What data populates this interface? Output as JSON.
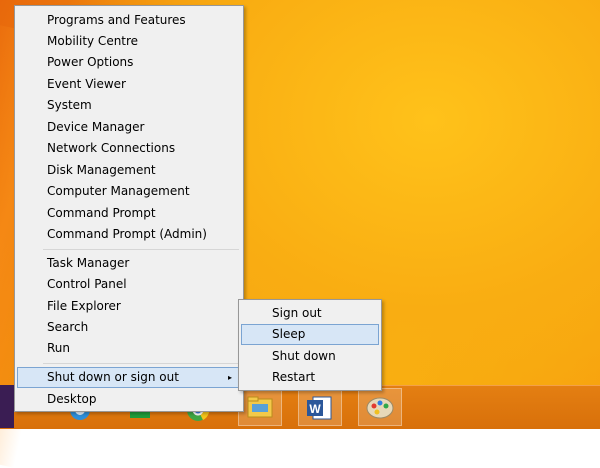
{
  "colors": {
    "menu_bg": "#f0f0f0",
    "highlight_bg": "#d7e6f6",
    "highlight_border": "#7ba4d2",
    "desktop_orange": "#f9ad12"
  },
  "menu": {
    "groups": [
      [
        "Programs and Features",
        "Mobility Centre",
        "Power Options",
        "Event Viewer",
        "System",
        "Device Manager",
        "Network Connections",
        "Disk Management",
        "Computer Management",
        "Command Prompt",
        "Command Prompt (Admin)"
      ],
      [
        "Task Manager",
        "Control Panel",
        "File Explorer",
        "Search",
        "Run"
      ],
      [
        "Shut down or sign out",
        "Desktop"
      ]
    ],
    "highlighted": "Shut down or sign out",
    "submenu_arrow": "▸"
  },
  "submenu": {
    "items": [
      "Sign out",
      "Sleep",
      "Shut down",
      "Restart"
    ],
    "highlighted": "Sleep"
  },
  "taskbar": {
    "icons": [
      "windows-start-icon",
      "ie-icon",
      "store-icon",
      "chrome-icon",
      "file-explorer-icon",
      "word-icon",
      "paint-icon"
    ],
    "word_letter": "W"
  }
}
